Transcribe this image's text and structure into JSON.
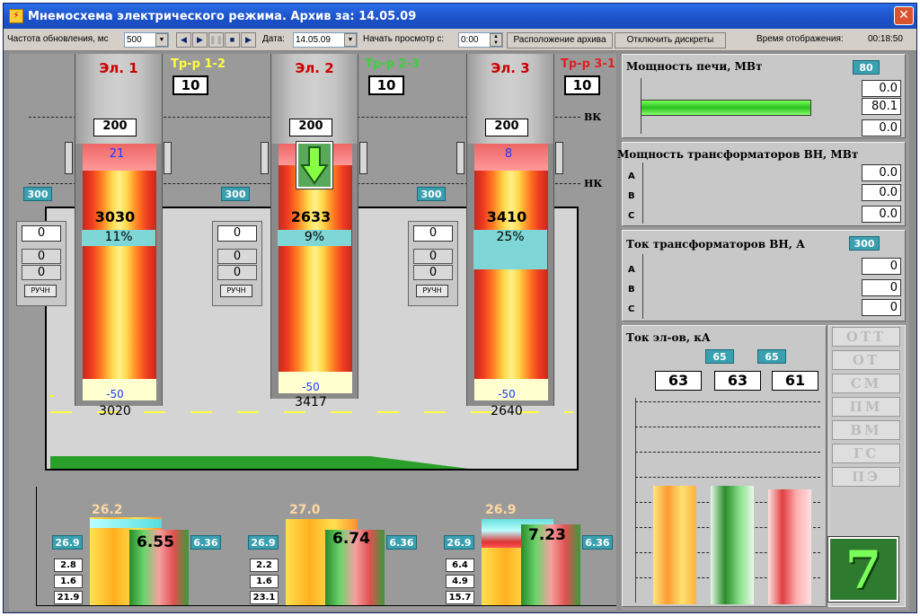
{
  "window": {
    "title": "Мнемосхема электрического режима. Архив за: 14.05.09",
    "close_icon": "close-icon",
    "app_icon": "app-icon"
  },
  "toolbar": {
    "refresh_label": "Частота обновления, мс",
    "refresh_value": "500",
    "date_label": "Дата:",
    "date_value": "14.05.09",
    "start_label": "Начать просмотр с:",
    "start_value": "0:00",
    "archive_button": "Расположение архива",
    "discrete_button": "Отключить дискреты",
    "display_time_label": "Время отображения:",
    "display_time_value": "00:18:50",
    "icons": [
      "rewind-icon",
      "play-icon",
      "pause-icon",
      "stop-icon",
      "fast-forward-icon"
    ]
  },
  "levels": {
    "top": "ВК",
    "bottom": "НК"
  },
  "electrodes": [
    {
      "name": "Эл. 1",
      "transformer": "Тр-р 1-2",
      "tr_color": "#ffff40",
      "tap": "10",
      "top_value": "200",
      "mark": "21",
      "side_value": "300",
      "power": "3030",
      "pct": "11%",
      "pct_fill": 0.11,
      "bottom_value": "-50",
      "position": "3020",
      "ctrl": [
        "0",
        "0",
        "0"
      ],
      "ctrl_button": "РУЧН",
      "arrow": false
    },
    {
      "name": "Эл. 2",
      "transformer": "Тр-р 2-3",
      "tr_color": "#40d040",
      "tap": "10",
      "top_value": "200",
      "mark": "",
      "side_value": "300",
      "power": "2633",
      "pct": "9%",
      "pct_fill": 0.09,
      "bottom_value": "-50",
      "position": "3417",
      "ctrl": [
        "0",
        "0",
        "0"
      ],
      "ctrl_button": "РУЧН",
      "arrow": true
    },
    {
      "name": "Эл. 3",
      "transformer": "Тр-р 3-1",
      "tr_color": "#e02020",
      "tap": "10",
      "top_value": "200",
      "mark": "8",
      "side_value": "300",
      "power": "3410",
      "pct": "25%",
      "pct_fill": 0.25,
      "bottom_value": "-50",
      "position": "2640",
      "ctrl": [
        "0",
        "0",
        "0"
      ],
      "ctrl_button": "РУЧН",
      "arrow": false
    }
  ],
  "bottom_bars": [
    {
      "top": "26.2",
      "left": "26.9",
      "right": "6.36",
      "mid": "6.55",
      "small": [
        "2.8",
        "1.6",
        "21.9"
      ]
    },
    {
      "top": "27.0",
      "left": "26.9",
      "right": "6.36",
      "mid": "6.74",
      "small": [
        "2.2",
        "1.6",
        "23.1"
      ]
    },
    {
      "top": "26.9",
      "left": "26.9",
      "right": "6.36",
      "mid": "7.23",
      "small": [
        "6.4",
        "4.9",
        "15.7"
      ]
    }
  ],
  "furnace_power": {
    "title": "Мощность печи, МВт",
    "badge": "80",
    "values": [
      "0.0",
      "80.1",
      "0.0"
    ],
    "fill": 0.8
  },
  "transformer_power": {
    "title": "Мощность трансформаторов ВН, МВт",
    "phases": [
      "A",
      "B",
      "C"
    ],
    "values": [
      "0.0",
      "0.0",
      "0.0"
    ]
  },
  "transformer_current": {
    "title": "Ток трансформаторов ВН, А",
    "badge": "300",
    "phases": [
      "A",
      "B",
      "C"
    ],
    "values": [
      "0",
      "0",
      "0"
    ]
  },
  "electrode_current": {
    "title": "Ток эл-ов, кА",
    "badges": [
      "65",
      "65"
    ],
    "values": [
      "63",
      "63",
      "61"
    ]
  },
  "modes": [
    "ОТТ",
    "ОТ",
    "СМ",
    "ПМ",
    "ВМ",
    "ГС",
    "ПЭ"
  ],
  "step": "7"
}
